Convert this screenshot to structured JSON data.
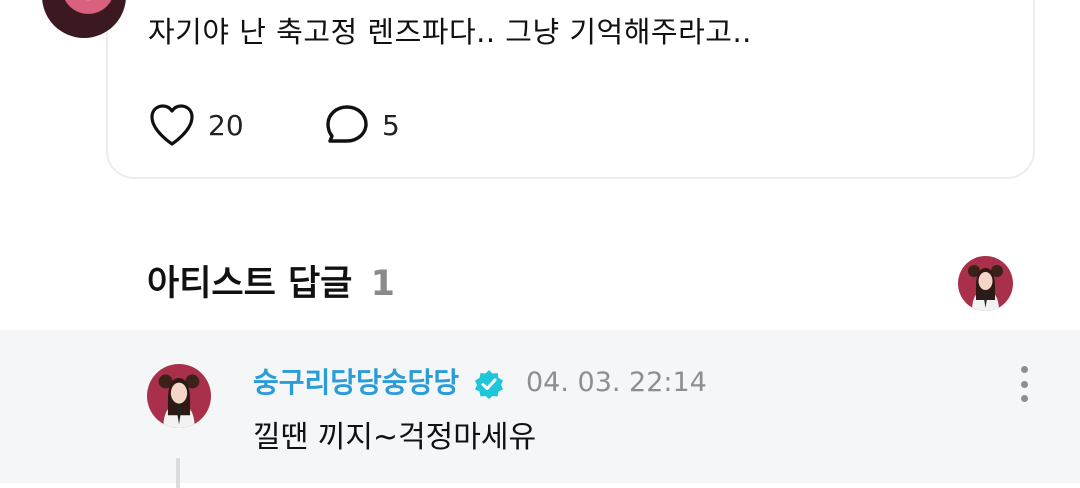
{
  "post": {
    "text": "자기야 난 축고정 렌즈파다.. 그냥 기억해주라고..",
    "like_count": "20",
    "comment_count": "5",
    "icons": {
      "like": "heart-icon",
      "comment": "speech-bubble-icon"
    }
  },
  "artist_replies": {
    "title": "아티스트 답글",
    "count": "1"
  },
  "reply": {
    "author": "숭구리당당숭당당",
    "verified_icon": "verified-badge-icon",
    "timestamp": "04. 03. 22:14",
    "text": "낄땐 끼지~걱정마세유"
  },
  "colors": {
    "author_name": "#2a9dd8",
    "verified_badge": "#1ec6d9",
    "reply_background": "#f5f6f8",
    "timestamp": "#8e8e8e"
  }
}
